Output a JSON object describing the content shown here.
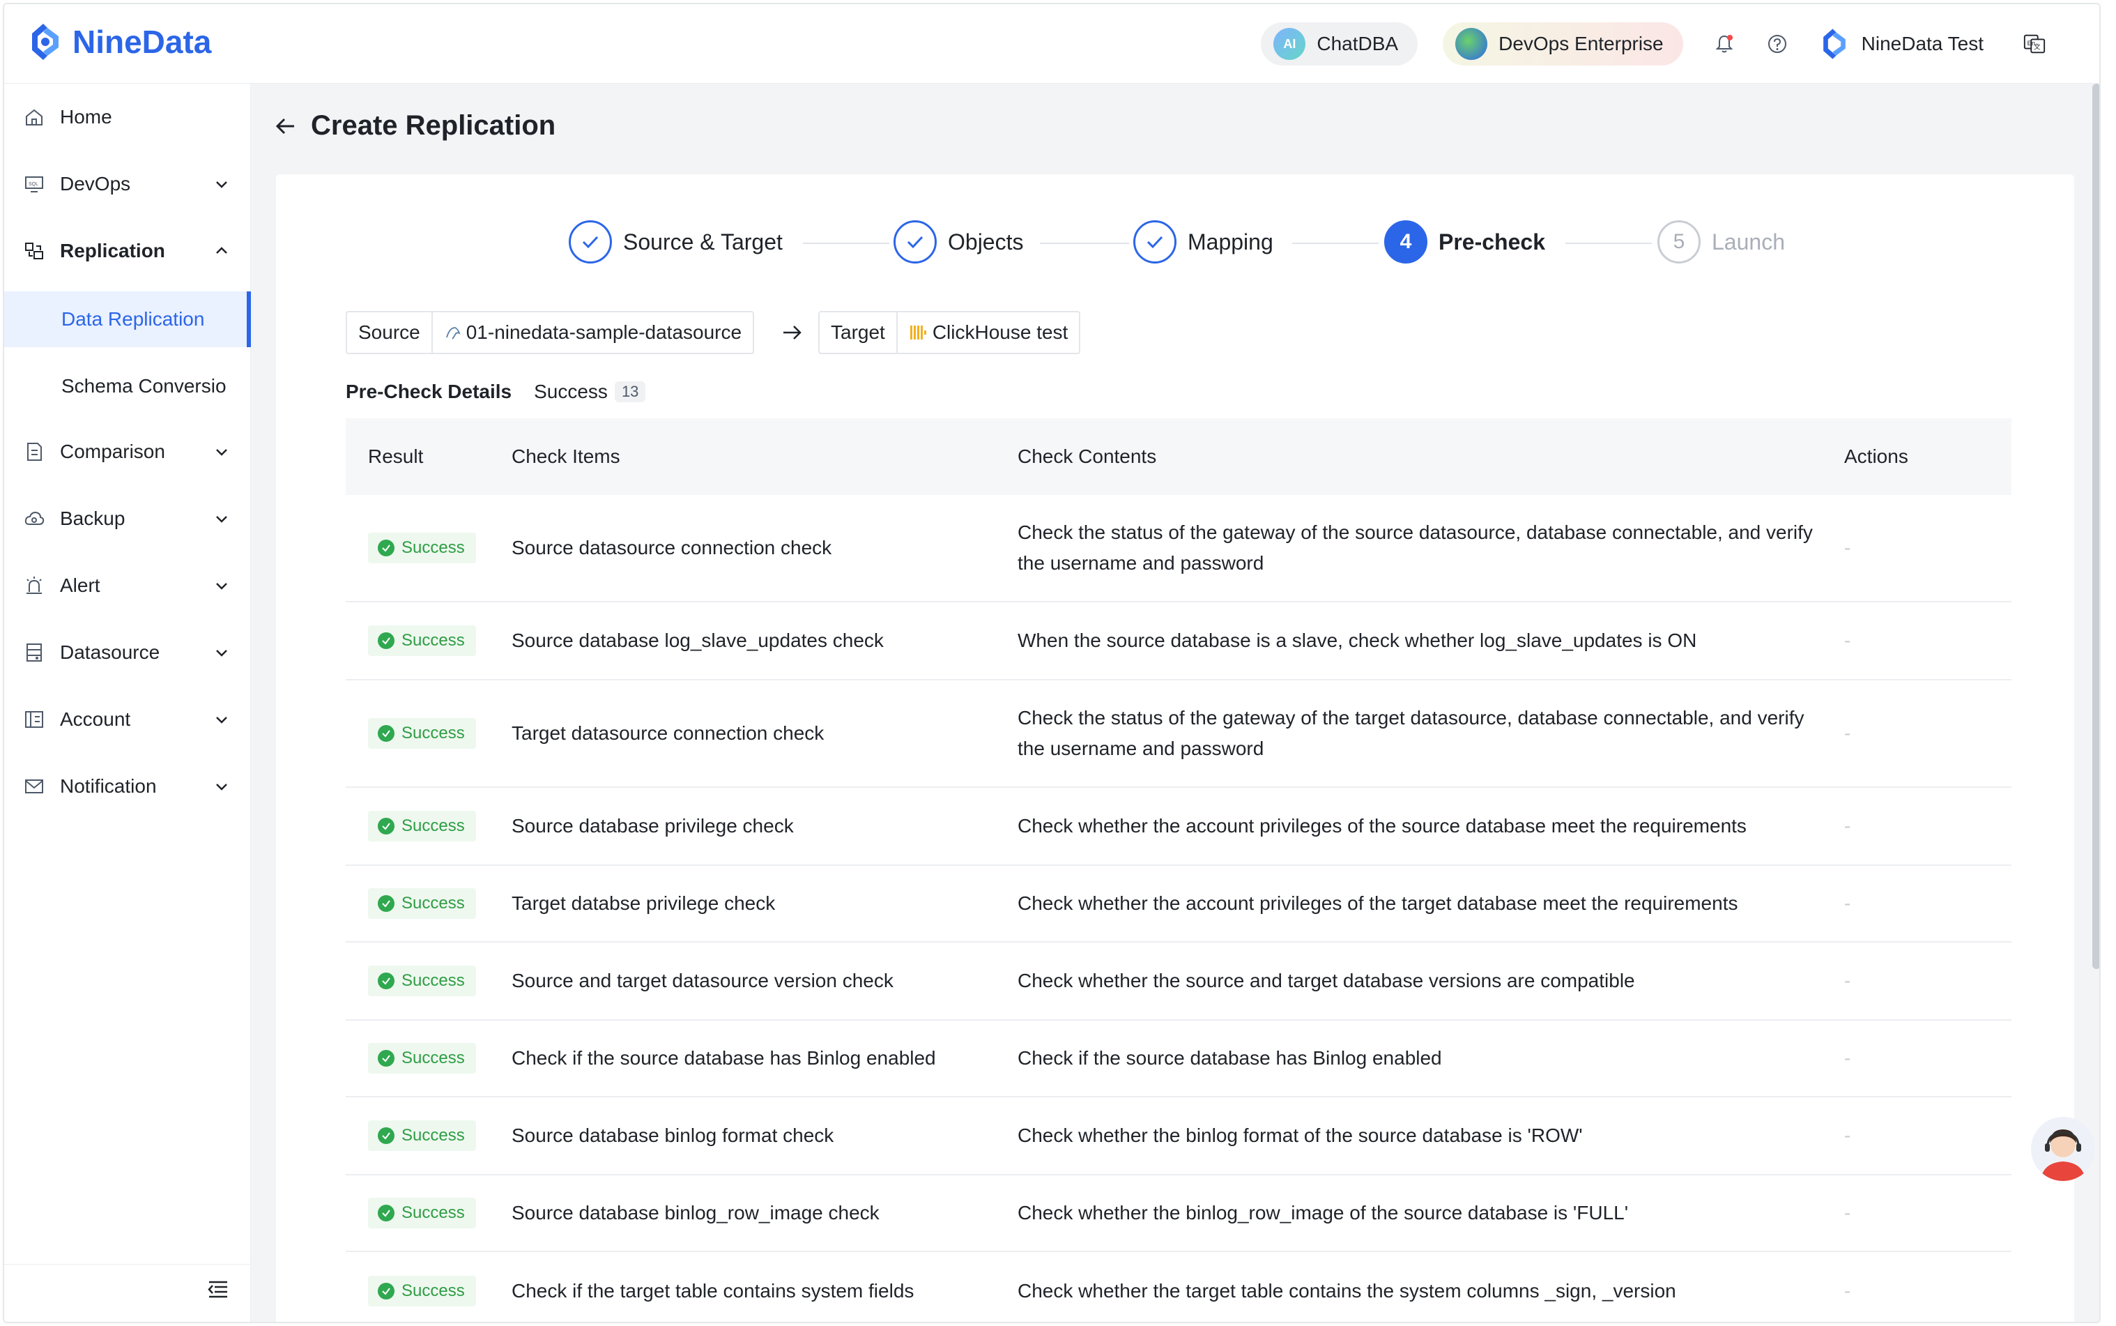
{
  "app": {
    "logo_text": "NineData",
    "brand_color": "#2c66e8"
  },
  "header": {
    "chat_label": "ChatDBA",
    "chat_icon_text": "AI",
    "edition_label": "DevOps Enterprise",
    "user_name": "NineData Test",
    "icons": [
      "bell-icon",
      "help-icon",
      "language-icon"
    ]
  },
  "sidebar": {
    "items": [
      {
        "label": "Home",
        "icon": "home-icon"
      },
      {
        "label": "DevOps",
        "icon": "sql-console-icon"
      },
      {
        "label": "Replication",
        "icon": "replication-icon"
      },
      {
        "label": "Comparison",
        "icon": "comparison-icon"
      },
      {
        "label": "Backup",
        "icon": "cloud-backup-icon"
      },
      {
        "label": "Alert",
        "icon": "alarm-icon"
      },
      {
        "label": "Datasource",
        "icon": "datasource-icon"
      },
      {
        "label": "Account",
        "icon": "account-icon"
      },
      {
        "label": "Notification",
        "icon": "mail-icon"
      }
    ],
    "sub_items": [
      {
        "label": "Data Replication",
        "active": true
      },
      {
        "label": "Schema Conversio",
        "active": false
      }
    ]
  },
  "page": {
    "title": "Create Replication"
  },
  "steps": [
    {
      "label": "Source & Target",
      "state": "done"
    },
    {
      "label": "Objects",
      "state": "done"
    },
    {
      "label": "Mapping",
      "state": "done"
    },
    {
      "label": "Pre-check",
      "number": "4",
      "state": "current"
    },
    {
      "label": "Launch",
      "number": "5",
      "state": "todo"
    }
  ],
  "source_target": {
    "source_label": "Source",
    "source_value": "01-ninedata-sample-datasource",
    "target_label": "Target",
    "target_value": "ClickHouse test"
  },
  "precheck": {
    "title": "Pre-Check Details",
    "status_label": "Success",
    "count": "13"
  },
  "table": {
    "columns": [
      "Result",
      "Check Items",
      "Check Contents",
      "Actions"
    ],
    "rows": [
      {
        "result": "Success",
        "item": "Source datasource connection check",
        "content": "Check the status of the gateway of the source datasource, database connectable, and verify the username and password",
        "action": "-"
      },
      {
        "result": "Success",
        "item": "Source database log_slave_updates check",
        "content": "When the source database is a slave, check whether log_slave_updates is ON",
        "action": "-"
      },
      {
        "result": "Success",
        "item": "Target datasource connection check",
        "content": "Check the status of the gateway of the target datasource, database connectable, and verify the username and password",
        "action": "-"
      },
      {
        "result": "Success",
        "item": "Source database privilege check",
        "content": "Check whether the account privileges of the source database meet the requirements",
        "action": "-"
      },
      {
        "result": "Success",
        "item": "Target databse privilege check",
        "content": "Check whether the account privileges of the target database meet the requirements",
        "action": "-"
      },
      {
        "result": "Success",
        "item": "Source and target datasource version check",
        "content": "Check whether the source and target database versions are compatible",
        "action": "-"
      },
      {
        "result": "Success",
        "item": "Check if the source database has Binlog enabled",
        "content": "Check if the source database has Binlog enabled",
        "action": "-"
      },
      {
        "result": "Success",
        "item": "Source database binlog format check",
        "content": "Check whether the binlog format of the source database is 'ROW'",
        "action": "-"
      },
      {
        "result": "Success",
        "item": "Source database binlog_row_image check",
        "content": "Check whether the binlog_row_image of the source database is 'FULL'",
        "action": "-"
      },
      {
        "result": "Success",
        "item": "Check if the target table contains system fields",
        "content": "Check whether the target table contains the system columns _sign, _version",
        "action": "-"
      }
    ]
  },
  "colors": {
    "success_text": "#2f9d45",
    "success_bg": "#eef8ef",
    "active_bg": "#eaf1ff"
  }
}
